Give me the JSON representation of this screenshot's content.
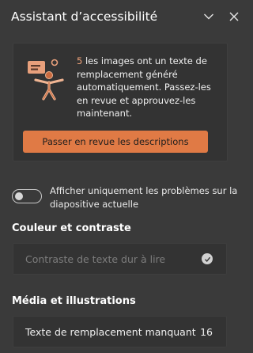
{
  "header": {
    "title": "Assistant d’accessibilité",
    "collapse_icon": "chevron-down-icon",
    "close_icon": "close-icon"
  },
  "card": {
    "illustration_icon": "accessibility-person-icon",
    "count": "5",
    "message": " les images ont un texte de remplacement généré automatiquement. Passez-les en revue et approuvez-les maintenant.",
    "button_label": "Passer en revue les descriptions",
    "button_color": "#e07a45"
  },
  "filter": {
    "toggle_on": false,
    "label": "Afficher uniquement les problèmes sur la diapositive actuelle"
  },
  "sections": {
    "color_contrast": {
      "title": "Couleur et contraste",
      "item_label": "Contraste de texte dur à lire",
      "item_icon": "checkmark-circle-icon"
    },
    "media": {
      "title": "Média et illustrations",
      "item_label": "Texte de remplacement manquant",
      "item_count": "16"
    }
  }
}
